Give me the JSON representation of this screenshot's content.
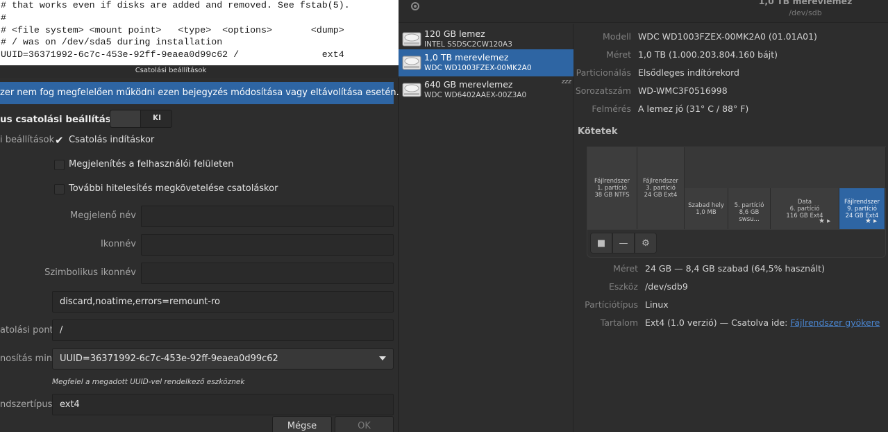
{
  "terminal": {
    "lines": [
      "# that works even if disks are added and removed. See fstab(5).",
      "#",
      "# <file system> <mount point>   <type>  <options>       <dump>",
      "# / was on /dev/sda5 during installation",
      "UUID=36371992-6c7c-453e-92ff-9eaea0d99c62 /               ext4"
    ]
  },
  "disks_window": {
    "title": "1,0 TB merevlemez",
    "subtitle": "/dev/sdb",
    "disk_list": [
      {
        "name": "120 GB lemez",
        "model": "INTEL SSDSC2CW120A3",
        "selected": false
      },
      {
        "name": "1,0 TB merevlemez",
        "model": "WDC WD1003FZEX-00MK2A0",
        "selected": true
      },
      {
        "name": "640 GB merevlemez",
        "model": "WDC WD6402AAEX-00Z3A0",
        "selected": false,
        "badge": "zzz"
      }
    ],
    "drive_props": [
      {
        "label": "Modell",
        "value": "WDC WD1003FZEX-00MK2A0 (01.01A01)"
      },
      {
        "label": "Méret",
        "value": "1,0 TB (1.000.203.804.160 bájt)"
      },
      {
        "label": "Particionálás",
        "value": "Elsődleges indítórekord"
      },
      {
        "label": "Sorozatszám",
        "value": "WD-WMC3F0516998"
      },
      {
        "label": "Felmérés",
        "value": "A lemez jó (31° C / 88° F)"
      }
    ],
    "volumes_title": "Kötetek",
    "volumes": [
      {
        "lines": [
          "Fájlrendszer",
          "1. partíció",
          "38 GB NTFS"
        ]
      },
      {
        "lines": [
          "Fájlrendszer",
          "3. partíció",
          "24 GB Ext4"
        ]
      },
      {
        "lines": [
          "Szabad hely",
          "1,0 MB"
        ]
      },
      {
        "lines": [
          "5. partíció",
          "8,6 GB swsu..."
        ]
      },
      {
        "lines": [
          "Data",
          "6. partíció",
          "116 GB Ext4"
        ]
      },
      {
        "lines": [
          "Fájlrendszer",
          "9. partíció",
          "24 GB Ext4"
        ]
      }
    ],
    "toolbar": {
      "stop_icon": "■",
      "minus_icon": "—",
      "gear_icon": "⚙"
    },
    "volume_props": [
      {
        "label": "Méret",
        "value": "24 GB — 8,4 GB szabad (64,5% használt)"
      },
      {
        "label": "Eszköz",
        "value": "/dev/sdb9"
      },
      {
        "label": "Partíciótípus",
        "value": "Linux"
      },
      {
        "label": "Tartalom",
        "value": "Ext4 (1.0 verzió) — Csatolva ide: ",
        "link": "Fájlrendszer gyökere"
      }
    ]
  },
  "dialog": {
    "title": "Csatolási beállítások",
    "warning": "zer nem fog megfelelően működni ezen bejegyzés módosítása vagy eltávolítása esetén.",
    "auto_label": "us csatolási beállítások",
    "switch_state": "KI",
    "options_label": "i beállítások",
    "checkboxes": [
      {
        "label": "Csatolás indításkor",
        "checked": true
      },
      {
        "label": "Megjelenítés a felhasználói felületen",
        "checked": false
      },
      {
        "label": "További hitelesítés megkövetelése csatoláskor",
        "checked": false
      }
    ],
    "display_name_label": "Megjelenő név",
    "display_name_value": "",
    "icon_name_label": "Ikonnév",
    "icon_name_value": "",
    "symbolic_icon_label": "Szimbolikus ikonnév",
    "symbolic_icon_value": "",
    "options_value": "discard,noatime,errors=remount-ro",
    "mount_point_label": "atolási pont",
    "mount_point_value": "/",
    "identify_label": "nosítás mint",
    "identify_value": "UUID=36371992-6c7c-453e-92ff-9eaea0d99c62",
    "identify_hint": "Megfelel a megadott UUID-vel rendelkező eszköznek",
    "fs_type_label": "ndszertípus",
    "fs_type_value": "ext4",
    "cancel_label": "Mégse",
    "ok_label": "OK"
  }
}
